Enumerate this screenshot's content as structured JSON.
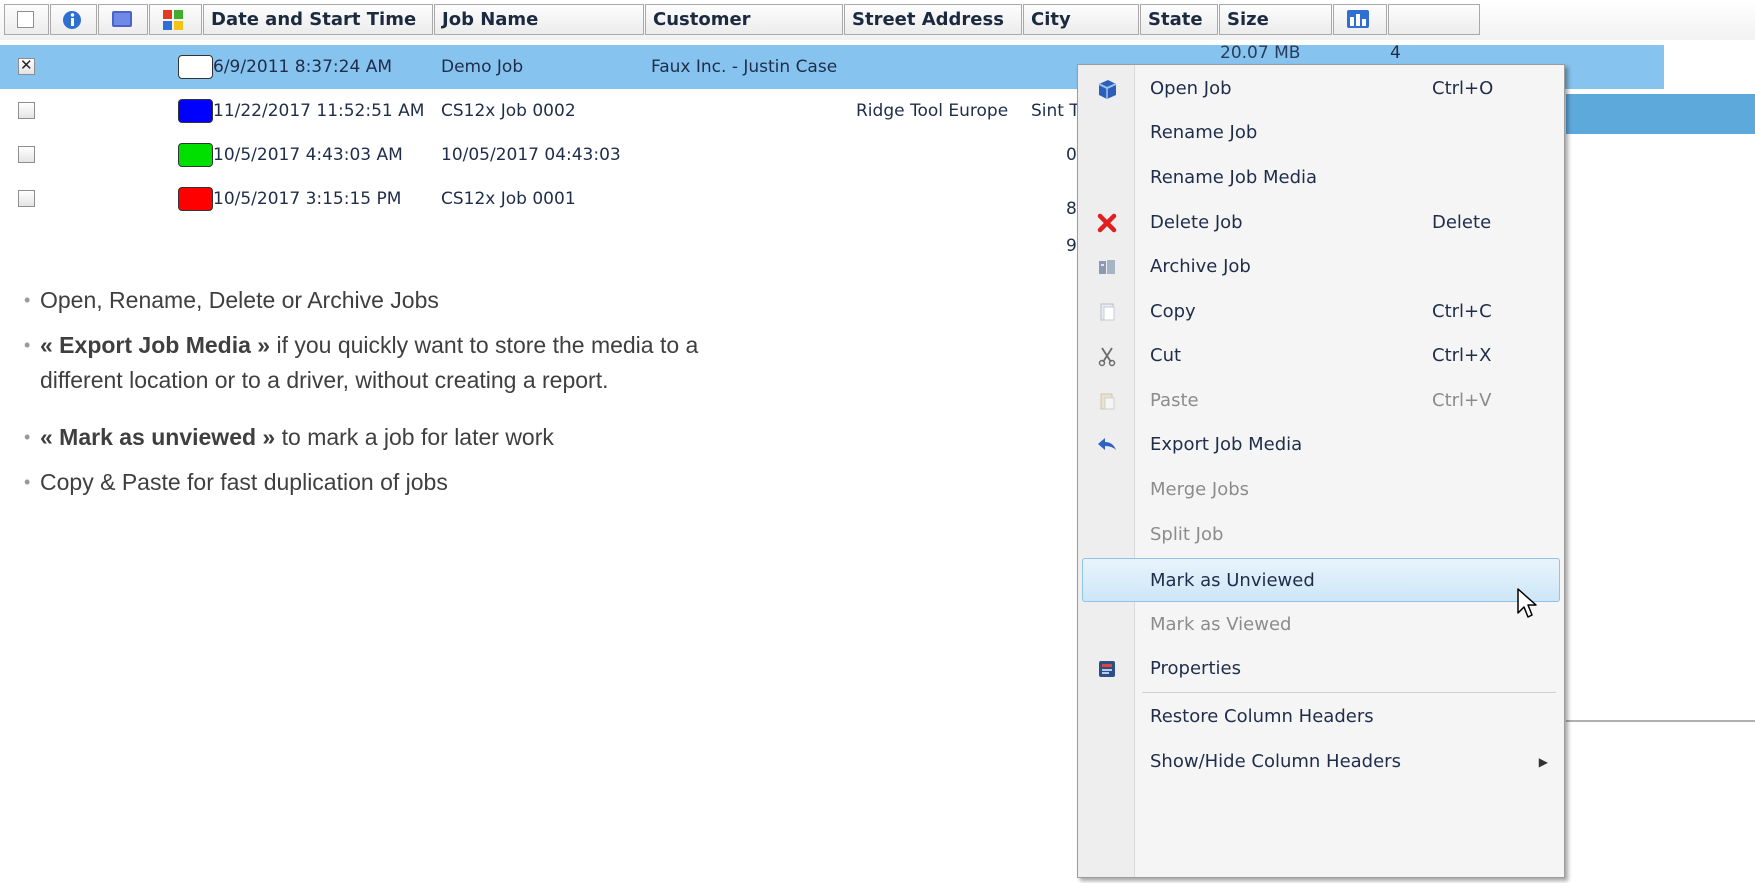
{
  "header": {
    "icons": [
      "checkbox-icon",
      "info-icon",
      "media-icon",
      "color-tag-icon"
    ],
    "columns": {
      "date": "Date and Start Time",
      "job_name": "Job Name",
      "customer": "Customer",
      "street": "Street Address",
      "city": "City",
      "state": "State",
      "size": "Size"
    },
    "chooser_icon": "column-chooser-icon"
  },
  "rows": [
    {
      "checked": true,
      "color": "#ffffff",
      "date": "6/9/2011 8:37:24 AM",
      "job_name": "Demo Job",
      "customer": "Faux Inc. - Justin Case",
      "street": "",
      "city": ""
    },
    {
      "checked": false,
      "color": "#0000ff",
      "date": "11/22/2017 11:52:51 AM",
      "job_name": "CS12x Job 0002",
      "customer": "",
      "street": "Ridge Tool Europe",
      "city": "Sint T"
    },
    {
      "checked": false,
      "color": "#00e000",
      "date": "10/5/2017 4:43:03 AM",
      "job_name": "10/05/2017 04:43:03",
      "customer": "",
      "street": "",
      "city": ""
    },
    {
      "checked": false,
      "color": "#ff0000",
      "date": "10/5/2017 3:15:15 PM",
      "job_name": "CS12x Job 0001",
      "customer": "",
      "street": "",
      "city": ""
    }
  ],
  "colors": {
    "selected_row": "#86c3ee",
    "menu_hover": "#cde6f7",
    "header_text": "#1c2a40",
    "disabled_text": "#8c8c8c"
  },
  "bullets": [
    {
      "bold": "",
      "text": "Open, Rename, Delete or Archive Jobs"
    },
    {
      "bold": "« Export Job Media »",
      "text": " if you quickly want to store the media to a",
      "text2": "different location or to a driver, without creating a report."
    },
    {
      "bold": "« Mark as unviewed »",
      "text": " to mark a job for later work"
    },
    {
      "bold": "",
      "text": "Copy & Paste for fast duplication of jobs"
    }
  ],
  "context_menu": {
    "items": [
      {
        "label": "Open Job",
        "shortcut": "Ctrl+O",
        "icon": "open-job-icon",
        "enabled": true
      },
      {
        "label": "Rename Job",
        "shortcut": "",
        "icon": "",
        "enabled": true
      },
      {
        "label": "Rename Job Media",
        "shortcut": "",
        "icon": "",
        "enabled": true
      },
      {
        "label": "Delete Job",
        "shortcut": "Delete",
        "icon": "delete-x-icon",
        "enabled": true
      },
      {
        "label": "Archive Job",
        "shortcut": "",
        "icon": "archive-icon",
        "enabled": true
      },
      {
        "label": "Copy",
        "shortcut": "Ctrl+C",
        "icon": "copy-icon",
        "enabled": true
      },
      {
        "label": "Cut",
        "shortcut": "Ctrl+X",
        "icon": "scissors-icon",
        "enabled": true
      },
      {
        "label": "Paste",
        "shortcut": "Ctrl+V",
        "icon": "paste-icon",
        "enabled": false
      },
      {
        "label": "Export Job Media",
        "shortcut": "",
        "icon": "export-arrow-icon",
        "enabled": true
      },
      {
        "label": "Merge Jobs",
        "shortcut": "",
        "icon": "",
        "enabled": false
      },
      {
        "label": "Split Job",
        "shortcut": "",
        "icon": "",
        "enabled": false
      },
      {
        "label": "Mark as Unviewed",
        "shortcut": "",
        "icon": "",
        "enabled": true,
        "hovered": true
      },
      {
        "label": "Mark as Viewed",
        "shortcut": "",
        "icon": "",
        "enabled": false
      },
      {
        "label": "Properties",
        "shortcut": "",
        "icon": "properties-icon",
        "enabled": true
      },
      {
        "label": "Restore Column Headers",
        "shortcut": "",
        "icon": "",
        "enabled": true
      },
      {
        "label": "Show/Hide Column Headers",
        "shortcut": "",
        "icon": "",
        "enabled": true,
        "submenu": true
      }
    ]
  },
  "background_partial": {
    "size_value": "20.07 MB",
    "count_value": "4",
    "row_fragments": [
      "0",
      "8",
      "9"
    ]
  }
}
